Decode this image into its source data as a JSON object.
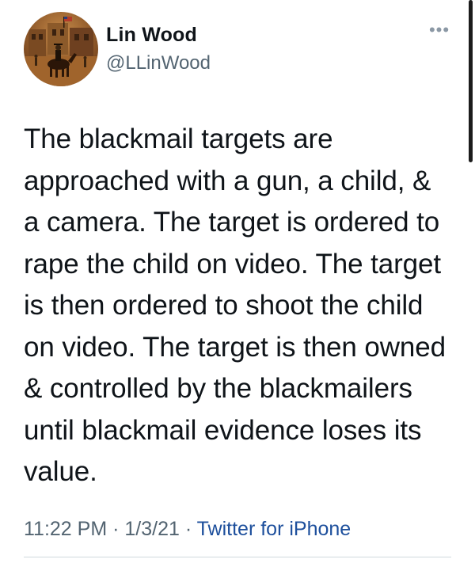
{
  "user": {
    "display_name": "Lin Wood",
    "handle": "@LLinWood",
    "avatar_icon": "profile-photo-horseback-rider"
  },
  "more_icon": "ellipsis-icon",
  "more_glyph": "•••",
  "tweet": {
    "text": "The blackmail targets are\napproached with a gun, a child, &\na camera. The target is ordered to\nrape the child on video. The target\nis then ordered to shoot the child\non video. The target is then owned\n& controlled by the blackmailers\nuntil blackmail evidence loses its\nvalue.",
    "time": "11:22 PM",
    "separator1": " · ",
    "date": "1/3/21",
    "separator2": " · ",
    "source": "Twitter for iPhone"
  },
  "colors": {
    "text": "#0f1419",
    "secondary": "#536471",
    "link": "#1d4f9c"
  }
}
